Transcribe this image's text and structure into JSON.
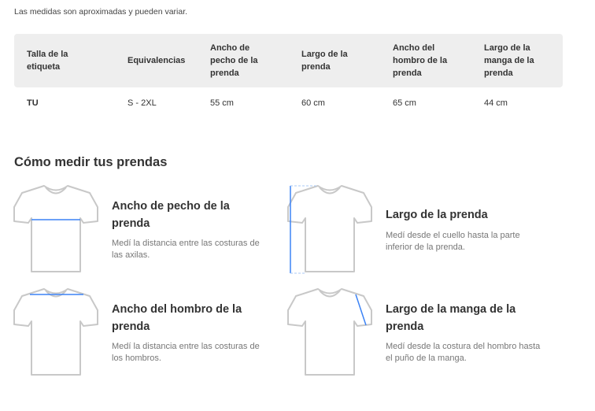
{
  "note": "Las medidas son aproximadas y pueden variar.",
  "table": {
    "headers": [
      "Talla de la etiqueta",
      "Equivalencias",
      "Ancho de pecho de la prenda",
      "Largo de la prenda",
      "Ancho del hombro de la prenda",
      "Largo de la manga de la prenda"
    ],
    "rows": [
      [
        "TU",
        "S - 2XL",
        "55 cm",
        "60 cm",
        "65 cm",
        "44 cm"
      ]
    ]
  },
  "how_to": {
    "title": "Cómo medir tus prendas",
    "cards": [
      {
        "title": "Ancho de pecho de la prenda",
        "description": "Medí la distancia entre las costuras de las axilas.",
        "icon": "shirt-chest-measure-icon"
      },
      {
        "title": "Largo de la prenda",
        "description": "Medí desde el cuello hasta la parte inferior de la prenda.",
        "icon": "shirt-length-measure-icon"
      },
      {
        "title": "Ancho del hombro de la prenda",
        "description": "Medí la distancia entre las costuras de los hombros.",
        "icon": "shirt-shoulder-measure-icon"
      },
      {
        "title": "Largo de la manga de la prenda",
        "description": "Medí desde la costura del hombro hasta el puño de la manga.",
        "icon": "shirt-sleeve-measure-icon"
      }
    ]
  },
  "colors": {
    "measure_line": "#3b82f6",
    "shirt_outline": "#c8c8c8",
    "header_bg": "#eeeeee"
  }
}
